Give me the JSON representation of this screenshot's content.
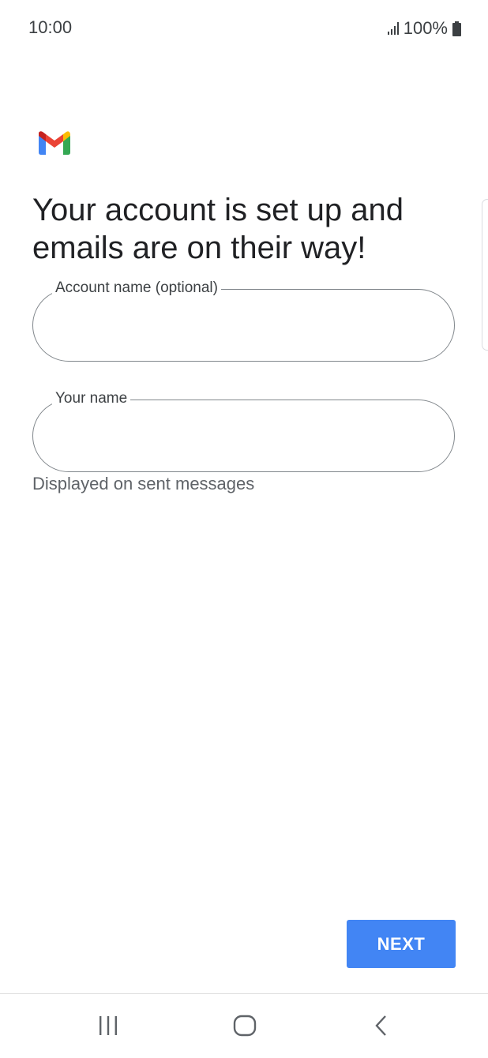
{
  "status_bar": {
    "time": "10:00",
    "battery": "100%"
  },
  "app": {
    "logo_icon": "gmail-logo",
    "colors": {
      "red": "#ea4335",
      "blue": "#4285f4",
      "green": "#34a853",
      "yellow": "#fbbc04",
      "dark_red": "#c5221f"
    }
  },
  "main": {
    "headline": "Your account is set up and emails are on their way!",
    "fields": {
      "account_name": {
        "label": "Account name (optional)",
        "value": ""
      },
      "your_name": {
        "label": "Your name",
        "value": "",
        "helper": "Displayed on sent messages"
      }
    },
    "next_label": "NEXT",
    "accent_color": "#4285f4"
  },
  "nav_bar": {
    "recent_icon": "recent-apps-icon",
    "home_icon": "home-icon",
    "back_icon": "back-icon"
  }
}
